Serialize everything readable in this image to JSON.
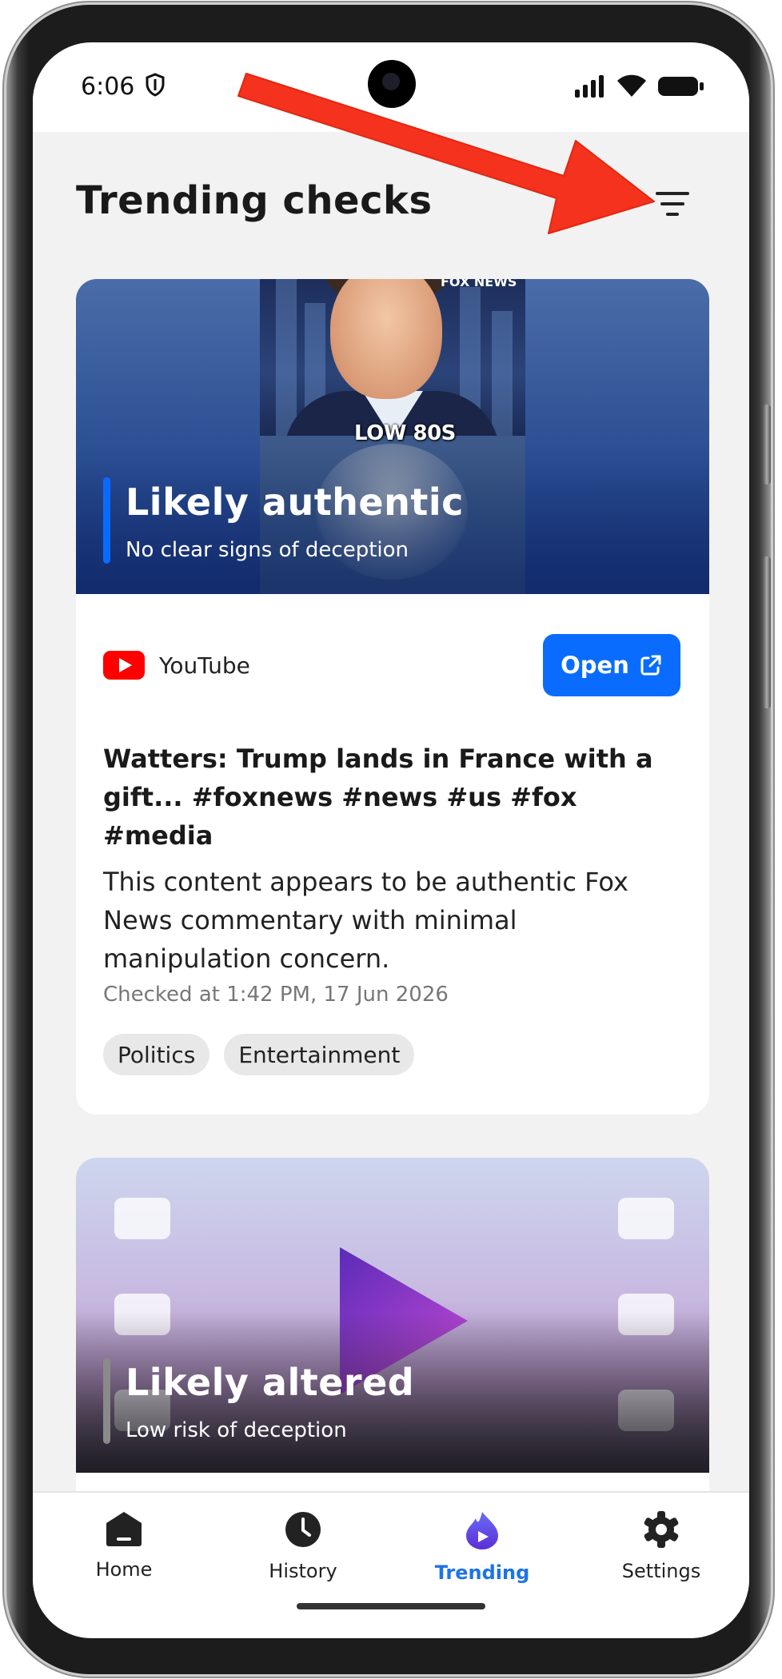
{
  "status_bar": {
    "time": "6:06"
  },
  "header": {
    "title": "Trending checks"
  },
  "cards": [
    {
      "verdict": "Likely authentic",
      "verdict_sub": "No clear signs of deception",
      "verdict_color": "#0a6cff",
      "thumbnail_caption": "LOW 80S",
      "thumbnail_logo": "FOX NEWS",
      "source": "YouTube",
      "open_label": "Open",
      "headline": "Watters: Trump lands in France with a gift... #foxnews #news #us #fox #media",
      "description": "This content appears to be authentic Fox News commentary with minimal manipulation concern.",
      "checked": "Checked at 1:42 PM, 17 Jun 2026",
      "tags": [
        "Politics",
        "Entertainment"
      ]
    },
    {
      "verdict": "Likely altered",
      "verdict_sub": "Low risk of deception",
      "verdict_color": "#8a8a8a"
    }
  ],
  "nav": [
    {
      "label": "Home",
      "icon": "home-icon"
    },
    {
      "label": "History",
      "icon": "clock-icon"
    },
    {
      "label": "Trending",
      "icon": "trending-flame-icon",
      "active": true
    },
    {
      "label": "Settings",
      "icon": "gear-icon"
    }
  ],
  "colors": {
    "accent": "#0a6cff",
    "active_nav": "#1e73e8",
    "annotation_arrow": "#f5321e"
  }
}
